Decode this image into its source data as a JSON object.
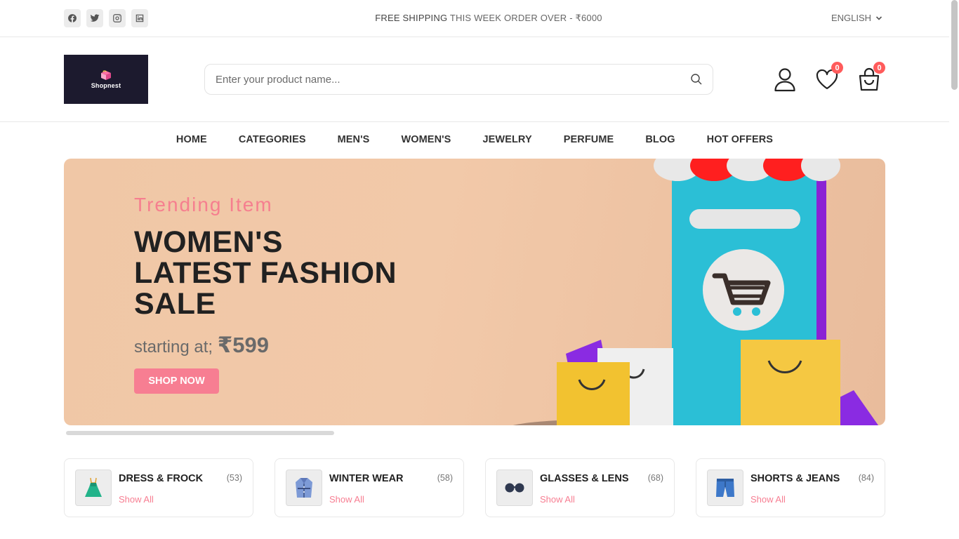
{
  "topbar": {
    "socials": [
      "facebook-icon",
      "twitter-icon",
      "instagram-icon",
      "linkedin-icon"
    ],
    "promo_strong": "FREE SHIPPING",
    "promo_rest": " THIS WEEK ORDER OVER - ₹6000",
    "language": "ENGLISH"
  },
  "header": {
    "logo_text": "Shopnest",
    "search_placeholder": "Enter your product name...",
    "wishlist_count": "0",
    "cart_count": "0"
  },
  "nav": {
    "items": [
      "HOME",
      "CATEGORIES",
      "MEN'S",
      "WOMEN'S",
      "JEWELRY",
      "PERFUME",
      "BLOG",
      "HOT OFFERS"
    ]
  },
  "banner": {
    "subtitle": "Trending Item",
    "title": "WOMEN'S LATEST FASHION SALE",
    "price_prefix": "starting at; ",
    "price": "₹599",
    "button": "SHOP NOW"
  },
  "categories": [
    {
      "name": "DRESS & FROCK",
      "count": "(53)",
      "link": "Show All",
      "icon": "dress-icon"
    },
    {
      "name": "WINTER WEAR",
      "count": "(58)",
      "link": "Show All",
      "icon": "winter-coat-icon"
    },
    {
      "name": "GLASSES & LENS",
      "count": "(68)",
      "link": "Show All",
      "icon": "glasses-icon"
    },
    {
      "name": "SHORTS & JEANS",
      "count": "(84)",
      "link": "Show All",
      "icon": "shorts-icon"
    }
  ],
  "colors": {
    "accent": "#f77e92",
    "badge": "#ff5b5b",
    "banner_bg": "#f0c7a6",
    "logo_bg": "#1c1a2e"
  }
}
